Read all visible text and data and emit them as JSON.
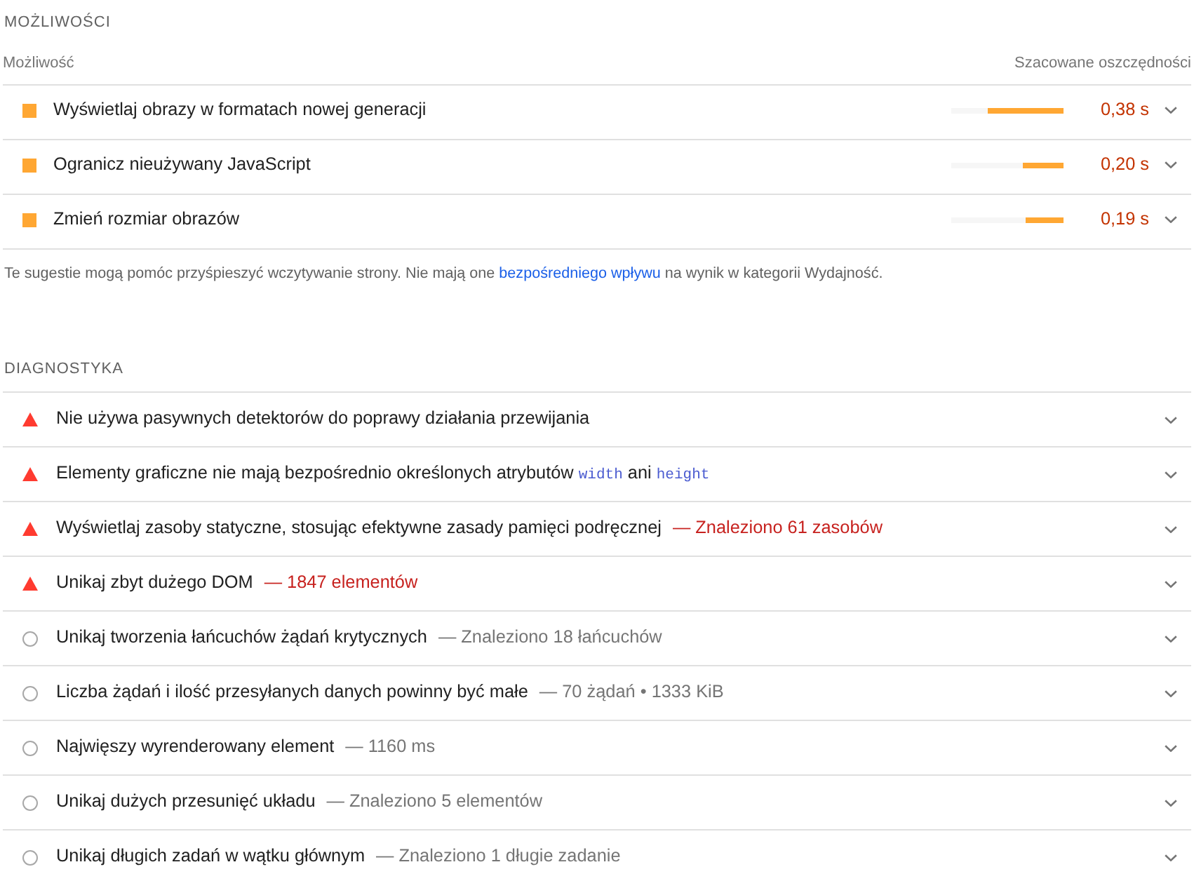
{
  "opportunities_section": {
    "title": "MOŻLIWOŚCI",
    "columns": [
      "Możliwość",
      "Szacowane oszczędności"
    ],
    "items": [
      {
        "kind": "average",
        "title": "Wyświetlaj obrazy w formatach nowej generacji",
        "level": 0.68,
        "savings": "0,38 s",
        "expanded": false
      },
      {
        "kind": "average",
        "title": "Ogranicz nieużywany JavaScript",
        "level": 0.36,
        "savings": "0,20 s",
        "expanded": false
      },
      {
        "kind": "average",
        "title": "Zmień rozmiar obrazów",
        "level": 0.34,
        "savings": "0,19 s",
        "expanded": false
      }
    ],
    "footnote": {
      "text_before": "Te sugestie mogą pomóc przyśpieszyć wczytywanie strony. Nie mają one ",
      "link": "bezpośredniego wpływu",
      "text_after": " na wynik w kategorii Wydajność."
    }
  },
  "diagnostics_section": {
    "title": "DIAGNOSTYKA",
    "items": [
      {
        "kind": "fail",
        "title_parts": [
          {
            "kind": "text",
            "text": "Nie używa pasywnych detektorów do poprawy działania przewijania"
          }
        ],
        "expanded": false
      },
      {
        "kind": "fail",
        "title_parts": [
          {
            "kind": "text",
            "text": "Elementy graficzne nie mają bezpośrednio określonych atrybutów "
          },
          {
            "kind": "code",
            "text": "width"
          },
          {
            "kind": "text",
            "text": " ani "
          },
          {
            "kind": "code",
            "text": "height"
          }
        ],
        "expanded": false
      },
      {
        "kind": "fail",
        "title_parts": [
          {
            "kind": "text",
            "text": "Wyświetlaj zasoby statyczne, stosując efektywne zasady pamięci podręcznej"
          }
        ],
        "display_value": "— Znaleziono 61 zasobów",
        "expanded": false
      },
      {
        "kind": "fail",
        "title_parts": [
          {
            "kind": "text",
            "text": "Unikaj zbyt dużego DOM"
          }
        ],
        "display_value": "— 1847 elementów",
        "expanded": false
      },
      {
        "kind": "informative",
        "title_parts": [
          {
            "kind": "text",
            "text": "Unikaj tworzenia łańcuchów żądań krytycznych"
          }
        ],
        "display_value": "— Znaleziono 18 łańcuchów",
        "expanded": false
      },
      {
        "kind": "informative",
        "title_parts": [
          {
            "kind": "text",
            "text": "Liczba żądań i ilość przesyłanych danych powinny być małe"
          }
        ],
        "display_value": "— 70 żądań • 1333 KiB",
        "expanded": false
      },
      {
        "kind": "informative",
        "title_parts": [
          {
            "kind": "text",
            "text": "Najwięszy wyrenderowany element"
          }
        ],
        "display_value": "— 1160 ms",
        "expanded": false
      },
      {
        "kind": "informative",
        "title_parts": [
          {
            "kind": "text",
            "text": "Unikaj dużych przesunięć układu"
          }
        ],
        "display_value": "— Znaleziono 5 elementów",
        "expanded": false
      },
      {
        "kind": "informative",
        "title_parts": [
          {
            "kind": "text",
            "text": "Unikaj długich zadań w wątku głównym"
          }
        ],
        "display_value": "— Znaleziono 1 długie zadanie",
        "expanded": false
      }
    ]
  }
}
